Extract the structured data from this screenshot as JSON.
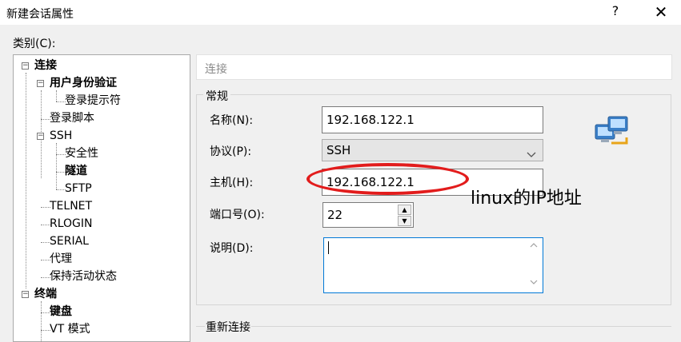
{
  "window": {
    "title": "新建会话属性",
    "help_glyph": "?",
    "close_glyph": "✕"
  },
  "category_label": "类别(C):",
  "tree": [
    {
      "label": "连接",
      "bold": true,
      "expander": "−"
    },
    {
      "label": "用户身份验证",
      "bold": true,
      "expander": "−"
    },
    {
      "label": "登录提示符",
      "bold": false
    },
    {
      "label": "登录脚本",
      "bold": false
    },
    {
      "label": "SSH",
      "bold": false,
      "expander": "−"
    },
    {
      "label": "安全性",
      "bold": false
    },
    {
      "label": "隧道",
      "bold": true
    },
    {
      "label": "SFTP",
      "bold": false
    },
    {
      "label": "TELNET",
      "bold": false
    },
    {
      "label": "RLOGIN",
      "bold": false
    },
    {
      "label": "SERIAL",
      "bold": false
    },
    {
      "label": "代理",
      "bold": false
    },
    {
      "label": "保持活动状态",
      "bold": false
    },
    {
      "label": "终端",
      "bold": true,
      "expander": "−"
    },
    {
      "label": "键盘",
      "bold": true
    },
    {
      "label": "VT 模式",
      "bold": false
    }
  ],
  "section_header": "连接",
  "general_group": {
    "title": "常规",
    "name_label": "名称(N):",
    "name_value": "192.168.122.1",
    "protocol_label": "协议(P):",
    "protocol_value": "SSH",
    "host_label": "主机(H):",
    "host_value": "192.168.122.1",
    "port_label": "端口号(O):",
    "port_value": "22",
    "desc_label": "说明(D):",
    "desc_value": ""
  },
  "annotation": "linux的IP地址",
  "reconnect_group": {
    "title": "重新连接"
  },
  "colors": {
    "annotation": "#e21c1c",
    "focus_border": "#0078d7"
  },
  "icons": {
    "help": "question-mark",
    "close": "close-x",
    "network": "network-computers-icon"
  }
}
